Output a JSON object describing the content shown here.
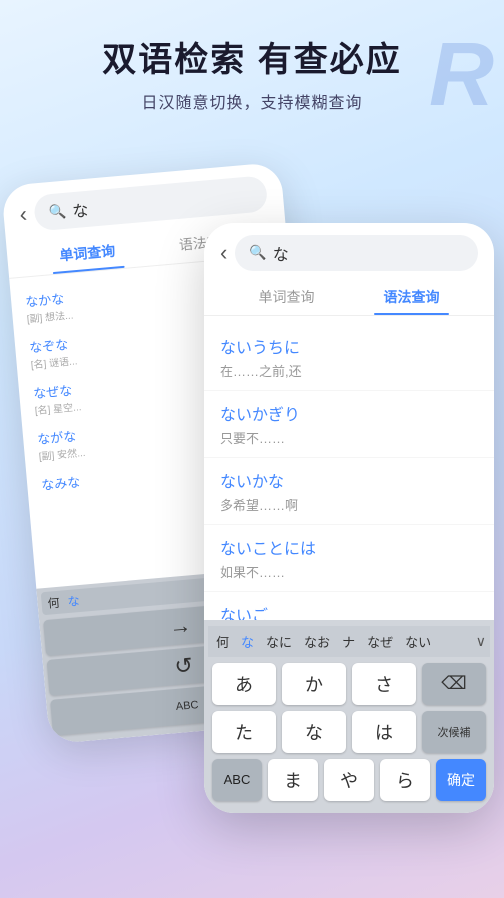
{
  "header": {
    "title": "双语检索 有查必应",
    "subtitle": "日汉随意切换，支持模糊查询",
    "logo": "R"
  },
  "back_phone": {
    "search_text": "な",
    "tabs": [
      {
        "label": "单词查询",
        "active": true
      },
      {
        "label": "语法查询",
        "active": false
      }
    ],
    "words": [
      {
        "jp": "なかな",
        "tag": "[副] 想法..."
      },
      {
        "jp": "なぞな",
        "tag": "[名] 谜语..."
      },
      {
        "jp": "なぜな",
        "tag": "[名] 星空..."
      },
      {
        "jp": "ながな",
        "tag": "[副] 安然..."
      },
      {
        "jp": "なみな",
        "tag": ""
      }
    ],
    "kana_row": [
      "何",
      "な"
    ],
    "kb_rows": [
      [
        {
          "label": "→",
          "type": "gray"
        },
        {
          "label": "↺",
          "type": "gray"
        },
        {
          "label": "ABC",
          "type": "abc"
        }
      ]
    ]
  },
  "front_phone": {
    "search_text": "な",
    "tabs": [
      {
        "label": "单词查询",
        "active": false
      },
      {
        "label": "语法查询",
        "active": true
      }
    ],
    "grammar_items": [
      {
        "jp": "ないうちに",
        "cn": "在……之前,还"
      },
      {
        "jp": "ないかぎり",
        "cn": "只要不……"
      },
      {
        "jp": "ないかな",
        "cn": "多希望……啊"
      },
      {
        "jp": "ないことには",
        "cn": "如果不……"
      },
      {
        "jp": "ないご",
        "cn": ""
      }
    ],
    "kana_row": [
      "何",
      "な",
      "なに",
      "なお",
      "ナ",
      "なぜ",
      "ない",
      "∨"
    ],
    "kb_rows": [
      [
        {
          "label": "あ",
          "type": "white"
        },
        {
          "label": "か",
          "type": "white"
        },
        {
          "label": "さ",
          "type": "white"
        },
        {
          "label": "⌫",
          "type": "delete"
        }
      ],
      [
        {
          "label": "た",
          "type": "white"
        },
        {
          "label": "な",
          "type": "white"
        },
        {
          "label": "は",
          "type": "white"
        },
        {
          "label": "次候補",
          "type": "next"
        }
      ],
      [
        {
          "label": "ABC",
          "type": "gray"
        },
        {
          "label": "ま",
          "type": "white"
        },
        {
          "label": "や",
          "type": "white"
        },
        {
          "label": "ら",
          "type": "white"
        },
        {
          "label": "确定",
          "type": "blue"
        }
      ]
    ]
  }
}
